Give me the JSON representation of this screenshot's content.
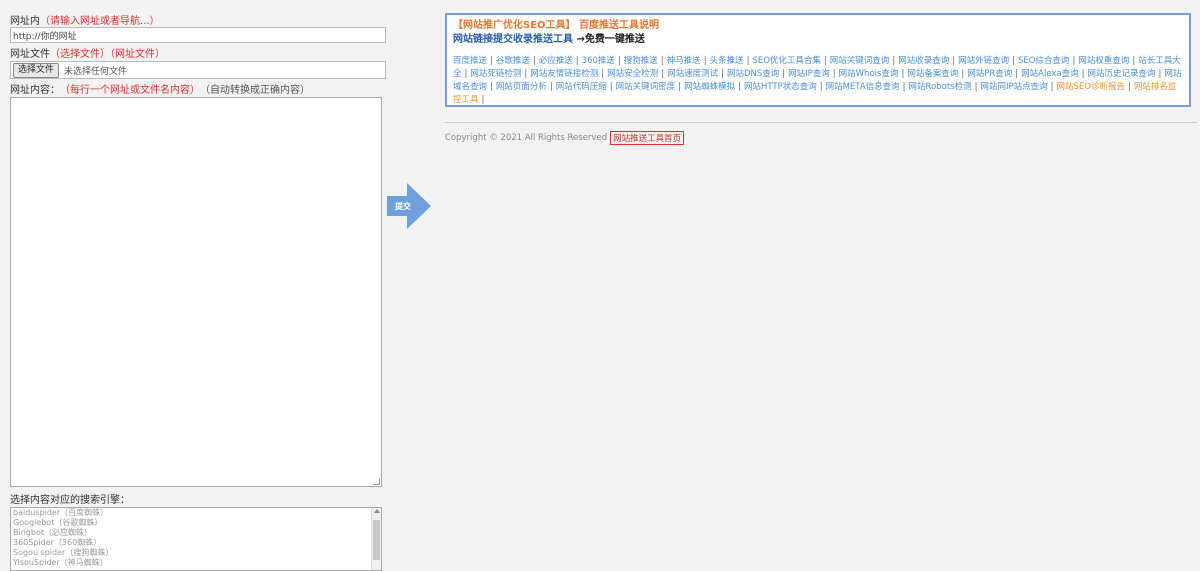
{
  "form": {
    "url_label": "网址内",
    "url_hint": "（请输入网址或者导航...）",
    "url_value": "http://你的网址",
    "file_label": "网址文件",
    "file_hint": "（选择文件）（网址文件）",
    "choose_btn": "选择文件",
    "no_file": "未选择任何文件",
    "content_label": "网址内容：",
    "content_hint": "（每行一个网址或文件名内容）",
    "content_sub": "（自动转换成正确内容）",
    "list_label": "选择内容对应的搜索引擎：",
    "list_options": [
      "baiduspider（百度蜘蛛）",
      "Googlebot（谷歌蜘蛛）",
      "Bingbot（必应蜘蛛）",
      "360Spider（360蜘蛛）",
      "Sogou spider（搜狗蜘蛛）",
      "YisouSpider（神马蜘蛛）"
    ]
  },
  "arrow": {
    "label": "提交"
  },
  "panel": {
    "title_a": "【网站推广优化SEO工具】",
    "title_b": "百度推送工具说明",
    "line2_a": "网站链接提交收录推送工具",
    "line2_b": "→免费一键推送",
    "links": [
      {
        "text": "百度推送",
        "color": "blue"
      },
      {
        "text": "谷歌推送",
        "color": "blue"
      },
      {
        "text": "必应推送",
        "color": "blue"
      },
      {
        "text": "360推送",
        "color": "blue"
      },
      {
        "text": "搜狗推送",
        "color": "blue"
      },
      {
        "text": "神马推送",
        "color": "blue"
      },
      {
        "text": "头条推送",
        "color": "blue"
      },
      {
        "text": "SEO优化工具合集",
        "color": "blue"
      },
      {
        "text": "网站关键词查询",
        "color": "blue"
      },
      {
        "text": "网站收录查询",
        "color": "blue"
      },
      {
        "text": "网站外链查询",
        "color": "blue"
      },
      {
        "text": "SEO综合查询",
        "color": "blue"
      },
      {
        "text": "网站权重查询",
        "color": "blue"
      },
      {
        "text": "站长工具大全",
        "color": "blue"
      },
      {
        "text": "网站死链检测",
        "color": "blue"
      },
      {
        "text": "网站友情链接检测",
        "color": "blue"
      },
      {
        "text": "网站安全检测",
        "color": "blue"
      },
      {
        "text": "网站速度测试",
        "color": "blue"
      },
      {
        "text": "网站DNS查询",
        "color": "blue"
      },
      {
        "text": "网站IP查询",
        "color": "blue"
      },
      {
        "text": "网站Whois查询",
        "color": "blue"
      },
      {
        "text": "网站备案查询",
        "color": "blue"
      },
      {
        "text": "网站PR查询",
        "color": "blue"
      },
      {
        "text": "网站Alexa查询",
        "color": "blue"
      },
      {
        "text": "网站历史记录查询",
        "color": "blue"
      },
      {
        "text": "网站域名查询",
        "color": "blue"
      },
      {
        "text": "网站页面分析",
        "color": "blue"
      },
      {
        "text": "网站代码压缩",
        "color": "blue"
      },
      {
        "text": "网站关键词密度",
        "color": "blue"
      },
      {
        "text": "网站蜘蛛模拟",
        "color": "blue"
      },
      {
        "text": "网站HTTP状态查询",
        "color": "blue"
      },
      {
        "text": "网站META信息查询",
        "color": "blue"
      },
      {
        "text": "网站Robots检测",
        "color": "blue"
      },
      {
        "text": "网站同IP站点查询",
        "color": "blue"
      },
      {
        "text": "网站SEO诊断报告",
        "color": "orange"
      },
      {
        "text": "网站排名监控工具",
        "color": "orange"
      }
    ]
  },
  "footer": {
    "copyright": "Copyright © 2021 All Rights Reserved",
    "link": "网站推送工具首页"
  }
}
